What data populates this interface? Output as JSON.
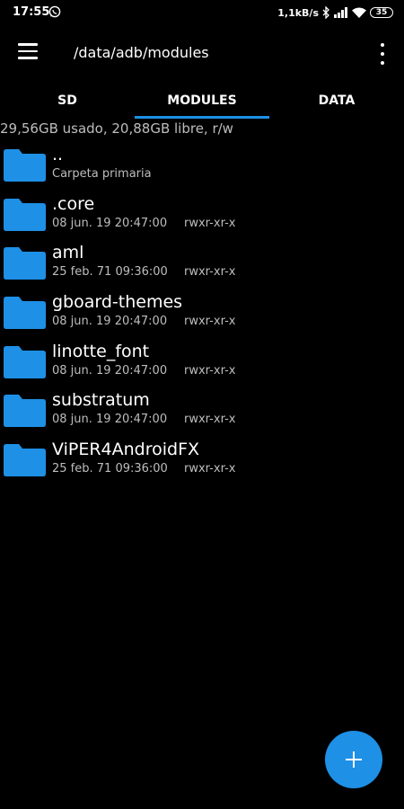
{
  "status_bar": {
    "time": "17:55",
    "net_speed": "1,1kB/s",
    "battery": "35"
  },
  "app_bar": {
    "path": "/data/adb/modules"
  },
  "tabs": [
    {
      "label": "SD"
    },
    {
      "label": "MODULES",
      "active": true
    },
    {
      "label": "DATA"
    }
  ],
  "storage_info": "29,56GB usado, 20,88GB libre, r/w",
  "files": [
    {
      "name": "..",
      "subtitle": "Carpeta primaria",
      "perm": ""
    },
    {
      "name": ".core",
      "subtitle": "08 jun. 19 20:47:00",
      "perm": "rwxr-xr-x"
    },
    {
      "name": "aml",
      "subtitle": "25 feb. 71 09:36:00",
      "perm": "rwxr-xr-x"
    },
    {
      "name": "gboard-themes",
      "subtitle": "08 jun. 19 20:47:00",
      "perm": "rwxr-xr-x"
    },
    {
      "name": "linotte_font",
      "subtitle": "08 jun. 19 20:47:00",
      "perm": "rwxr-xr-x"
    },
    {
      "name": "substratum",
      "subtitle": "08 jun. 19 20:47:00",
      "perm": "rwxr-xr-x"
    },
    {
      "name": "ViPER4AndroidFX",
      "subtitle": "25 feb. 71 09:36:00",
      "perm": "rwxr-xr-x"
    }
  ],
  "icons": {
    "menu": "hamburger-menu-icon",
    "overflow": "more-vert-icon",
    "folder": "folder-icon",
    "fab": "plus-icon"
  },
  "colors": {
    "accent": "#1e90e6",
    "background": "#000000",
    "secondary_text": "#bdbdbd"
  }
}
